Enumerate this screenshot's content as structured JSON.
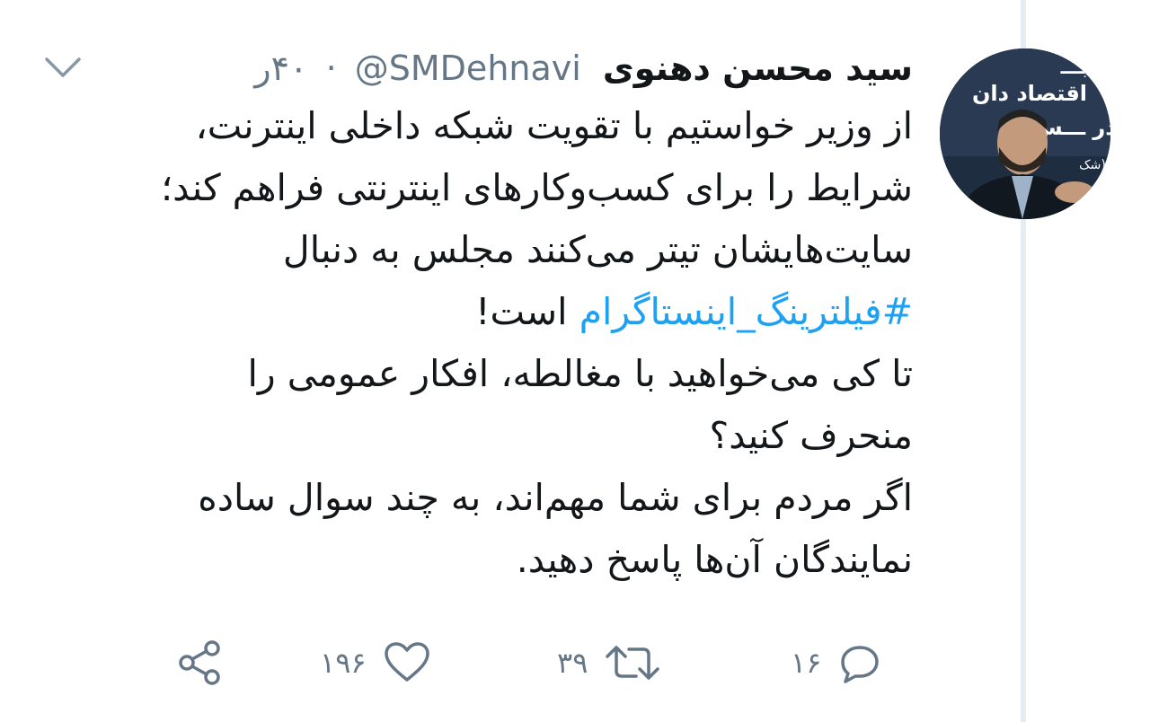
{
  "tweet": {
    "author_name": "سید محسن دهنوی",
    "handle": "@SMDehnavi",
    "separator": "·",
    "time": "۴۰ر",
    "text_lines": [
      "از وزیر خواستیم با تقویت شبکه داخلی اینترنت،",
      "شرایط را برای کسب‌وکارهای اینترنتی فراهم کند؛",
      "سایت‌هایشان تیتر می‌کنند مجلس به دنبال"
    ],
    "hashtag": "#فیلترینگ_اینستاگرام",
    "hashtag_suffix": " است!",
    "text_lines_after": [
      "تا کی می‌خواهید با مغالطه، افکار عمومی را",
      "منحرف کنید؟",
      "اگر مردم برای شما مهم‌اند، به چند سوال ساده",
      "نمایندگان آن‌ها پاسخ دهید."
    ],
    "avatar_text": "اقتصاد دان / در ـــس / (شک"
  },
  "actions": {
    "replies": "۱۶",
    "retweets": "۳۹",
    "likes": "۱۹۶"
  },
  "icons": {
    "caret": "chevron-down-icon",
    "reply": "reply-icon",
    "retweet": "retweet-icon",
    "like": "heart-icon",
    "share": "share-icon"
  },
  "colors": {
    "text": "#14171a",
    "muted": "#657786",
    "hashtag": "#1da1f2",
    "divider": "#e6ecf0"
  }
}
